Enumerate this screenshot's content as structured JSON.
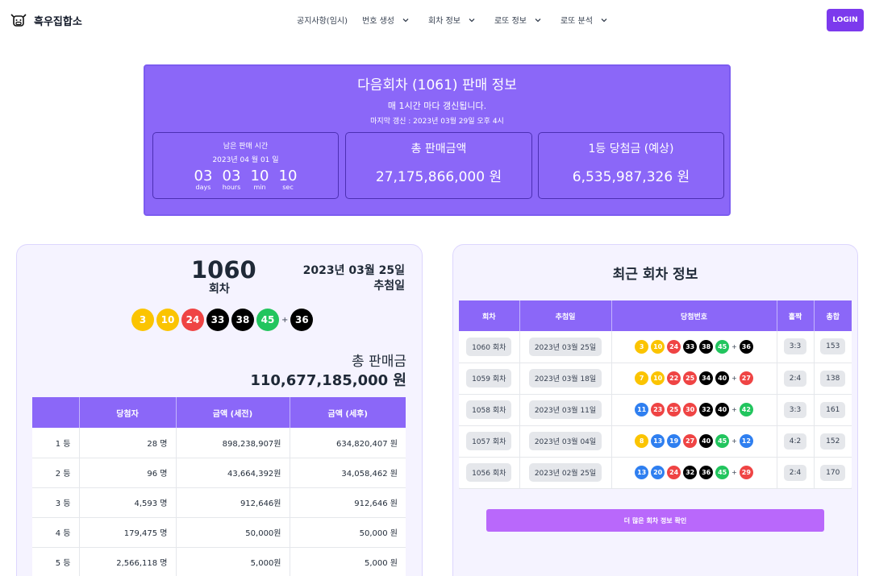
{
  "nav": {
    "brand": "흑우집합소",
    "menu": [
      "공지사항(임시)",
      "번호 생성",
      "회차 정보",
      "로또 정보",
      "로또 분석"
    ],
    "login": "LOGIN"
  },
  "sales": {
    "title": "다음회차 (1061) 판매 정보",
    "subtitle": "매 1시간 마다 갱신됩니다.",
    "updated": "마지막 갱신 : 2023년 03월 29일 오후 4시",
    "remaining_label": "남은 판매 시간",
    "remaining_date": "2023년 04 월 01 일",
    "countdown": [
      {
        "num": "03",
        "label": "days"
      },
      {
        "num": "03",
        "label": "hours"
      },
      {
        "num": "10",
        "label": "min"
      },
      {
        "num": "10",
        "label": "sec"
      }
    ],
    "total_label": "총 판매금액",
    "total_value": "27,175,866,000 원",
    "prize_label": "1등 당첨금 (예상)",
    "prize_value": "6,535,987,326 원"
  },
  "latest": {
    "round": "1060",
    "round_label": "회차",
    "date": "2023년 03월 25일",
    "date_label": "추첨일",
    "numbers": [
      3,
      10,
      24,
      33,
      38,
      45
    ],
    "bonus": 36,
    "total_label": "총 판매금",
    "total_value": "110,677,185,000 원",
    "headers": [
      "",
      "당첨자",
      "금액 (세전)",
      "금액 (세후)"
    ],
    "rows": [
      [
        "1 등",
        "28 명",
        "898,238,907원",
        "634,820,407 원"
      ],
      [
        "2 등",
        "96 명",
        "43,664,392원",
        "34,058,462 원"
      ],
      [
        "3 등",
        "4,593 명",
        "912,646원",
        "912,646 원"
      ],
      [
        "4 등",
        "179,475 명",
        "50,000원",
        "50,000 원"
      ],
      [
        "5 등",
        "2,566,118 명",
        "5,000원",
        "5,000 원"
      ]
    ]
  },
  "recent": {
    "title": "최근 회차 정보",
    "headers": [
      "회차",
      "추첨일",
      "당첨번호",
      "홀짝",
      "총합"
    ],
    "rows": [
      {
        "round": "1060 회차",
        "date": "2023년 03월 25일",
        "numbers": [
          3,
          10,
          24,
          33,
          38,
          45
        ],
        "bonus": 36,
        "oddeven": "3:3",
        "sum": "153"
      },
      {
        "round": "1059 회차",
        "date": "2023년 03월 18일",
        "numbers": [
          7,
          10,
          22,
          25,
          34,
          40
        ],
        "bonus": 27,
        "oddeven": "2:4",
        "sum": "138"
      },
      {
        "round": "1058 회차",
        "date": "2023년 03월 11일",
        "numbers": [
          11,
          23,
          25,
          30,
          32,
          40
        ],
        "bonus": 42,
        "oddeven": "3:3",
        "sum": "161"
      },
      {
        "round": "1057 회차",
        "date": "2023년 03월 04일",
        "numbers": [
          8,
          13,
          19,
          27,
          40,
          45
        ],
        "bonus": 12,
        "oddeven": "4:2",
        "sum": "152"
      },
      {
        "round": "1056 회차",
        "date": "2023년 02월 25일",
        "numbers": [
          13,
          20,
          24,
          32,
          36,
          45
        ],
        "bonus": 29,
        "oddeven": "2:4",
        "sum": "170"
      }
    ],
    "more_button": "더 많은 회차 정보 확인"
  },
  "colors": {
    "accent": "#8b67f8",
    "login": "#7c3aed",
    "more_button": "#b968fb",
    "ball_yellow": "#fbc400",
    "ball_blue": "#2f7ff0",
    "ball_red": "#ef4444",
    "ball_black": "#000000",
    "ball_green": "#22c55e"
  }
}
